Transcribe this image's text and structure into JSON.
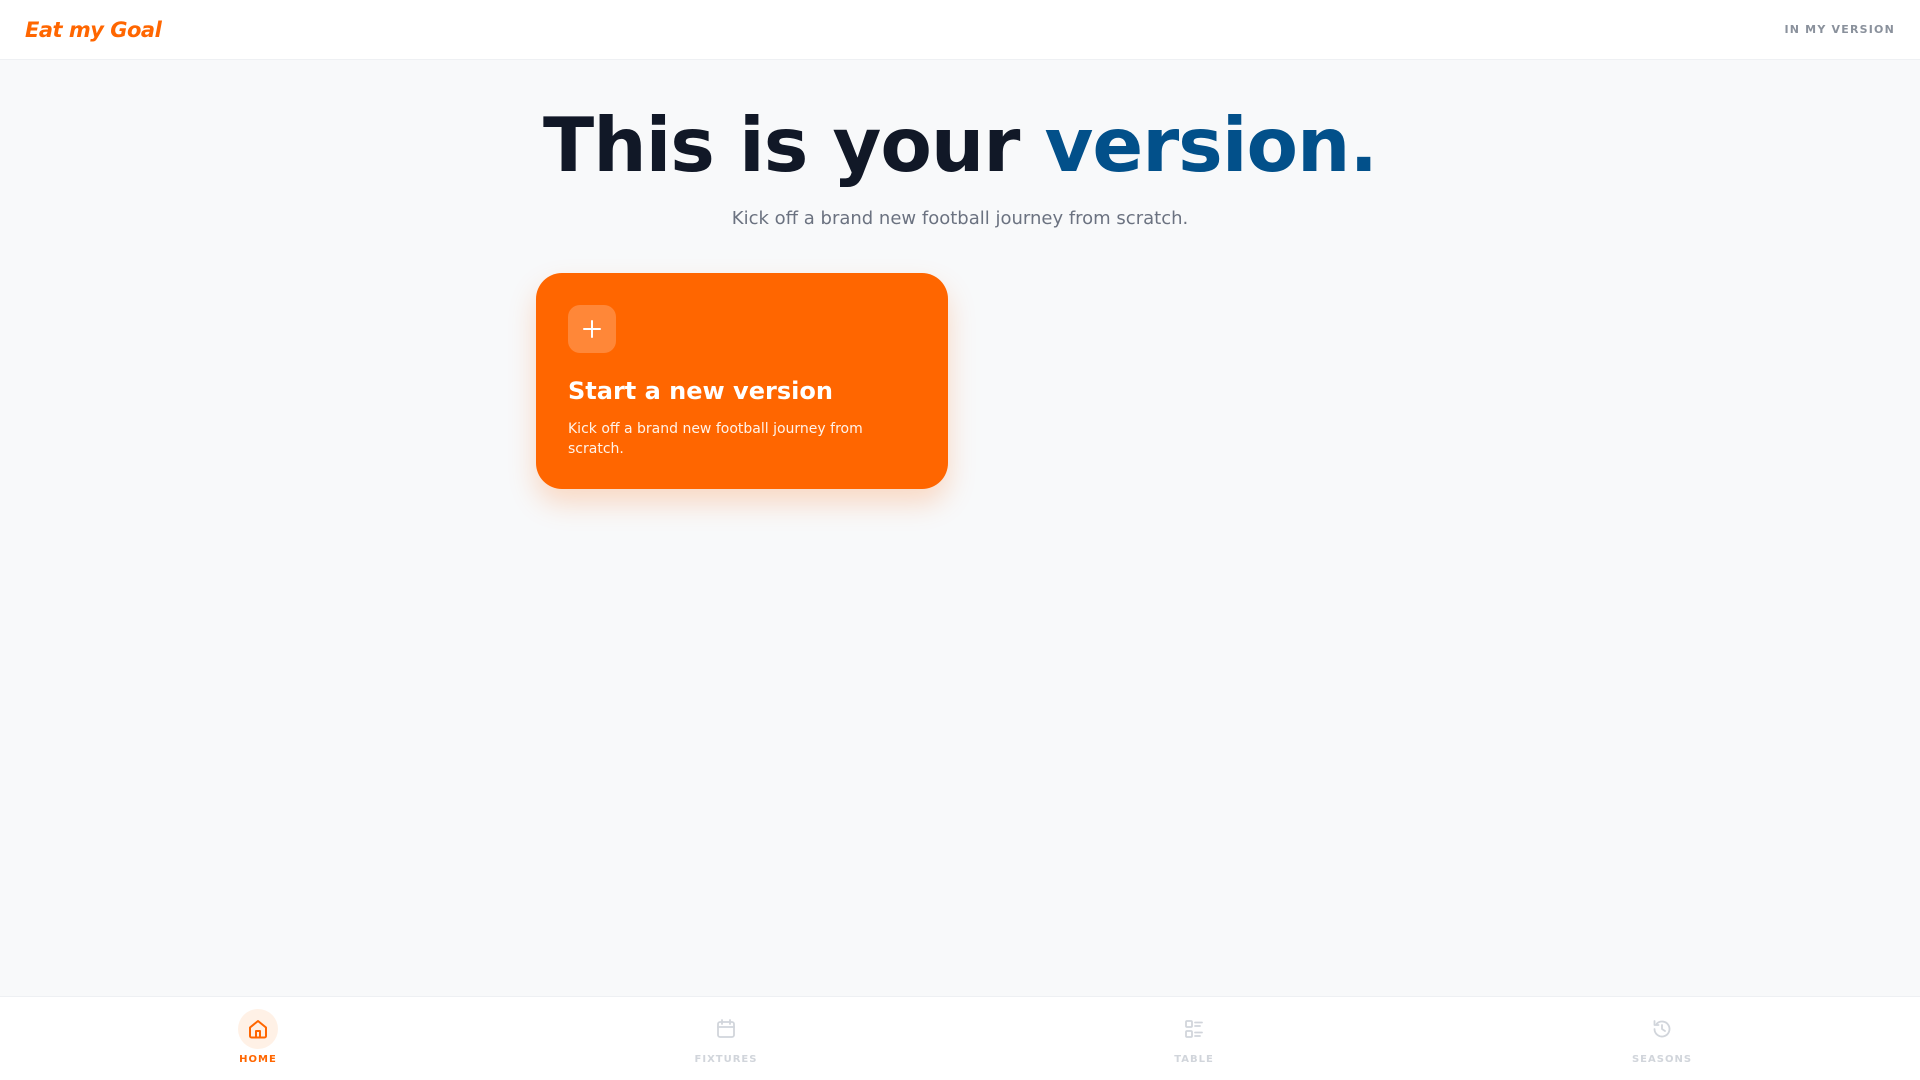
{
  "header": {
    "brand": "Eat my Goal",
    "status": "IN MY VERSION"
  },
  "hero": {
    "title_main": "This is your ",
    "title_accent": "version.",
    "subtitle": "Kick off a brand new football journey from scratch."
  },
  "new_version_card": {
    "icon": "plus-icon",
    "title": "Start a new version",
    "description": "Kick off a brand new football journey from scratch."
  },
  "bottom_nav": {
    "items": [
      {
        "label": "HOME",
        "icon": "home-icon",
        "active": true
      },
      {
        "label": "FIXTURES",
        "icon": "calendar-icon",
        "active": false
      },
      {
        "label": "TABLE",
        "icon": "table-list-icon",
        "active": false
      },
      {
        "label": "SEASONS",
        "icon": "history-icon",
        "active": false
      }
    ]
  },
  "colors": {
    "brand_orange": "#ff6600",
    "accent_blue": "#02508a",
    "heading_dark": "#111827",
    "muted_text": "#6b7280",
    "background": "#f8f9fa"
  }
}
